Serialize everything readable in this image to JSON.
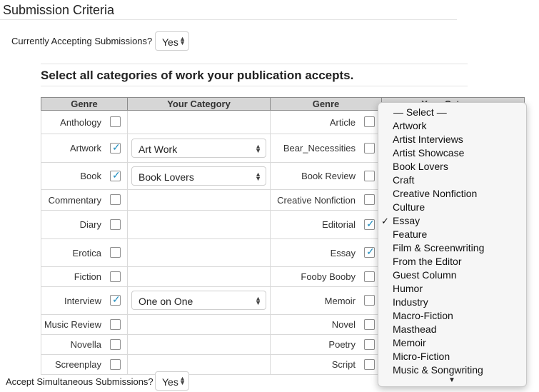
{
  "page": {
    "title": "Submission Criteria",
    "accepting_label": "Currently Accepting Submissions?",
    "accepting_value": "Yes",
    "categories_heading": "Select all categories of work your publication accepts.",
    "simultaneous_label": "Accept Simultaneous Submissions?",
    "simultaneous_value": "Yes"
  },
  "table": {
    "headers": [
      "Genre",
      "Your Category",
      "Genre",
      "Your Category"
    ],
    "rows": [
      {
        "g1": "Anthology",
        "c1": false,
        "cat1": "",
        "g2": "Article",
        "c2": false
      },
      {
        "g1": "Artwork",
        "c1": true,
        "cat1": "Art Work",
        "g2": "Bear_Necessities",
        "c2": false
      },
      {
        "g1": "Book",
        "c1": true,
        "cat1": "Book Lovers",
        "g2": "Book Review",
        "c2": false
      },
      {
        "g1": "Commentary",
        "c1": false,
        "cat1": "",
        "g2": "Creative Nonfiction",
        "c2": false
      },
      {
        "g1": "Diary",
        "c1": false,
        "cat1": "",
        "g2": "Editorial",
        "c2": true
      },
      {
        "g1": "Erotica",
        "c1": false,
        "cat1": "",
        "g2": "Essay",
        "c2": true
      },
      {
        "g1": "Fiction",
        "c1": false,
        "cat1": "",
        "g2": "Fooby Booby",
        "c2": false
      },
      {
        "g1": "Interview",
        "c1": true,
        "cat1": "One on One",
        "g2": "Memoir",
        "c2": false
      },
      {
        "g1": "Music Review",
        "c1": false,
        "cat1": "",
        "g2": "Novel",
        "c2": false
      },
      {
        "g1": "Novella",
        "c1": false,
        "cat1": "",
        "g2": "Poetry",
        "c2": false
      },
      {
        "g1": "Screenplay",
        "c1": false,
        "cat1": "",
        "g2": "Script",
        "c2": false
      }
    ]
  },
  "dropdown": {
    "placeholder": "— Select —",
    "selected": "Essay",
    "options": [
      "Artwork",
      "Artist Interviews",
      "Artist Showcase",
      "Book Lovers",
      "Craft",
      "Creative Nonfiction",
      "Culture",
      "Essay",
      "Feature",
      "Film & Screenwriting",
      "From the Editor",
      "Guest Column",
      "Humor",
      "Industry",
      "Macro-Fiction",
      "Masthead",
      "Memoir",
      "Micro-Fiction",
      "Music & Songwriting"
    ],
    "check_glyph": "✓",
    "scroll_glyph": "▼"
  },
  "glyphs": {
    "checkmark": "✓",
    "updown": "▲▼"
  },
  "colors": {
    "check": "#1e8cbe",
    "header_bg": "#d6d6d6"
  }
}
